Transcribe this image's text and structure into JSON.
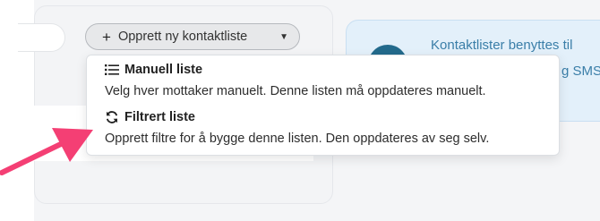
{
  "toolbar": {
    "create_label": "Opprett ny kontaktliste",
    "plus_icon": "plus-icon",
    "caret_icon": "caret-down-icon"
  },
  "menu": {
    "items": [
      {
        "title": "Manuell liste",
        "description": "Velg hver mottaker manuelt. Denne listen må oppdateres manuelt.",
        "icon": "list-icon"
      },
      {
        "title": "Filtrert liste",
        "description": "Opprett filtre for å bygge denne listen. Den oppdateres av seg selv.",
        "icon": "refresh-icon"
      }
    ]
  },
  "info": {
    "line1": "Kontaktlister benyttes til",
    "line2": "g SMS"
  },
  "colors": {
    "accent_arrow": "#f43f74",
    "info_bg": "#e3f0fa",
    "info_text": "#3a7ea8",
    "info_circle": "#236a8c"
  }
}
